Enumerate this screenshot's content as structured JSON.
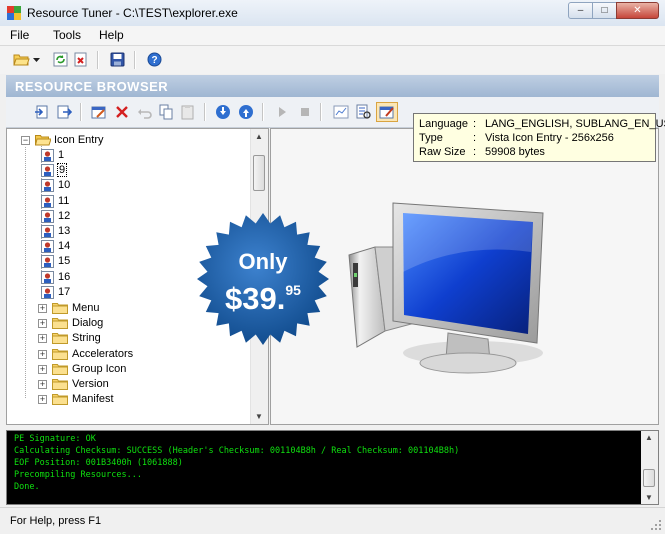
{
  "window": {
    "title": "Resource Tuner - C:\\TEST\\explorer.exe",
    "controls": {
      "minimize": "–",
      "maximize": "□",
      "close": "✕"
    }
  },
  "menu": [
    "File",
    "Tools",
    "Help"
  ],
  "toolbar": {
    "icons": [
      "open-folder-icon",
      "dropdown-arrow-icon",
      "refresh-icon",
      "delete-file-icon",
      "save-icon",
      "help-icon"
    ]
  },
  "resource_browser": {
    "title": "RESOURCE BROWSER",
    "toolbar_icons": [
      "import-icon",
      "export-icon",
      "edit-icon",
      "delete-icon",
      "undo-icon",
      "copy-icon",
      "paste-icon",
      "down-circle-icon",
      "up-circle-icon",
      "play-icon",
      "stop-icon",
      "chart-icon",
      "report-icon",
      "properties-icon"
    ]
  },
  "tooltip": {
    "rows": [
      {
        "key": "Language",
        "value": "LANG_ENGLISH, SUBLANG_EN_US"
      },
      {
        "key": "Type",
        "value": "Vista Icon Entry - 256x256"
      },
      {
        "key": "Raw Size",
        "value": "59908 bytes"
      }
    ]
  },
  "tree": {
    "root": {
      "label": "Icon Entry",
      "expanded": true
    },
    "entries": [
      "1",
      "9",
      "10",
      "11",
      "12",
      "13",
      "14",
      "15",
      "16",
      "17"
    ],
    "selected": "9",
    "folders": [
      "Menu",
      "Dialog",
      "String",
      "Accelerators",
      "Group Icon",
      "Version",
      "Manifest"
    ]
  },
  "promo": {
    "line1": "Only",
    "price": "$39.",
    "cents": "95",
    "color": "#1d5b9e"
  },
  "console": {
    "lines": [
      "PE Signature: OK",
      "Calculating Checksum: SUCCESS (Header's Checksum: 001104B8h / Real Checksum: 001104B8h)",
      "EOF Position: 001B3400h  (1061888)",
      "Precompiling Resources...",
      "Done."
    ],
    "text_color": "#0fe00f"
  },
  "status": {
    "text": "For Help, press F1"
  }
}
